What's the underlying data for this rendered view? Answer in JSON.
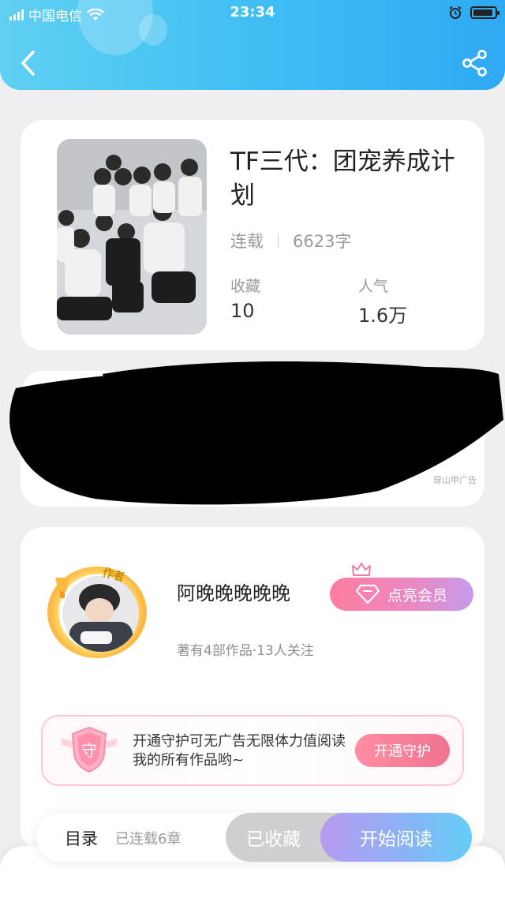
{
  "status_bar": {
    "carrier": "中国电信",
    "time": "23:34"
  },
  "header": {
    "back_icon": "chevron-left-icon",
    "share_icon": "share-icon",
    "color_start": "#5fd0f2",
    "color_end": "#2fa9f3"
  },
  "book": {
    "title": "TF三代：团宠养成计划",
    "status": "连载",
    "word_count": "6623字",
    "favorites_label": "收藏",
    "favorites_value": "10",
    "popularity_label": "人气",
    "popularity_value": "1.6万"
  },
  "ad": {
    "tag": "穿山甲广告"
  },
  "author": {
    "tag": "作者",
    "name": "阿晚晚晚晚晚",
    "vip_label": "点亮会员",
    "meta": "著有4部作品·13人关注"
  },
  "guard": {
    "badge": "守",
    "text": "开通守护可无广告无限体力值阅读我的所有作品哟~",
    "button_label": "开通守护"
  },
  "bottom_bar": {
    "toc_label": "目录",
    "chapter_count": "已连载6章",
    "favorite_label": "已收藏",
    "read_label": "开始阅读"
  }
}
